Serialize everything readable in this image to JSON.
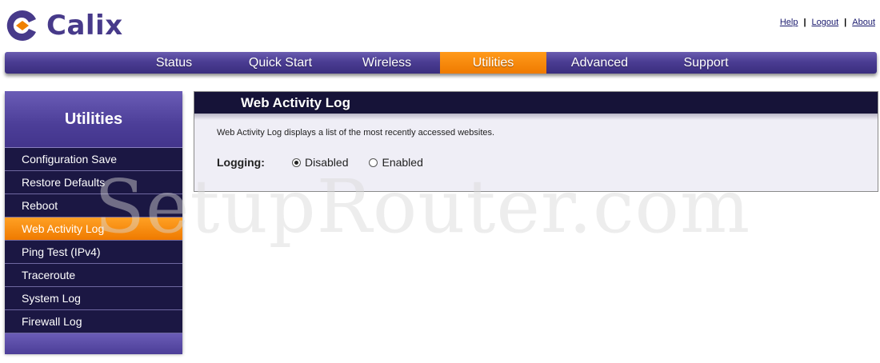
{
  "brand": {
    "name": "Calix",
    "color": "#473a8a",
    "accent": "#f08000"
  },
  "toplinks": [
    "Help",
    "Logout",
    "About"
  ],
  "nav": {
    "items": [
      "Status",
      "Quick Start",
      "Wireless",
      "Utilities",
      "Advanced",
      "Support"
    ],
    "active": "Utilities"
  },
  "sidebar": {
    "title": "Utilities",
    "items": [
      "Configuration Save",
      "Restore Defaults",
      "Reboot",
      "Web Activity Log",
      "Ping Test (IPv4)",
      "Traceroute",
      "System Log",
      "Firewall Log"
    ],
    "active": "Web Activity Log"
  },
  "content": {
    "title": "Web Activity Log",
    "description": "Web Activity Log displays a list of the most recently accessed websites.",
    "logging": {
      "label": "Logging:",
      "options": [
        "Disabled",
        "Enabled"
      ],
      "selected": "Disabled"
    }
  },
  "watermark": "SetupRouter.com"
}
